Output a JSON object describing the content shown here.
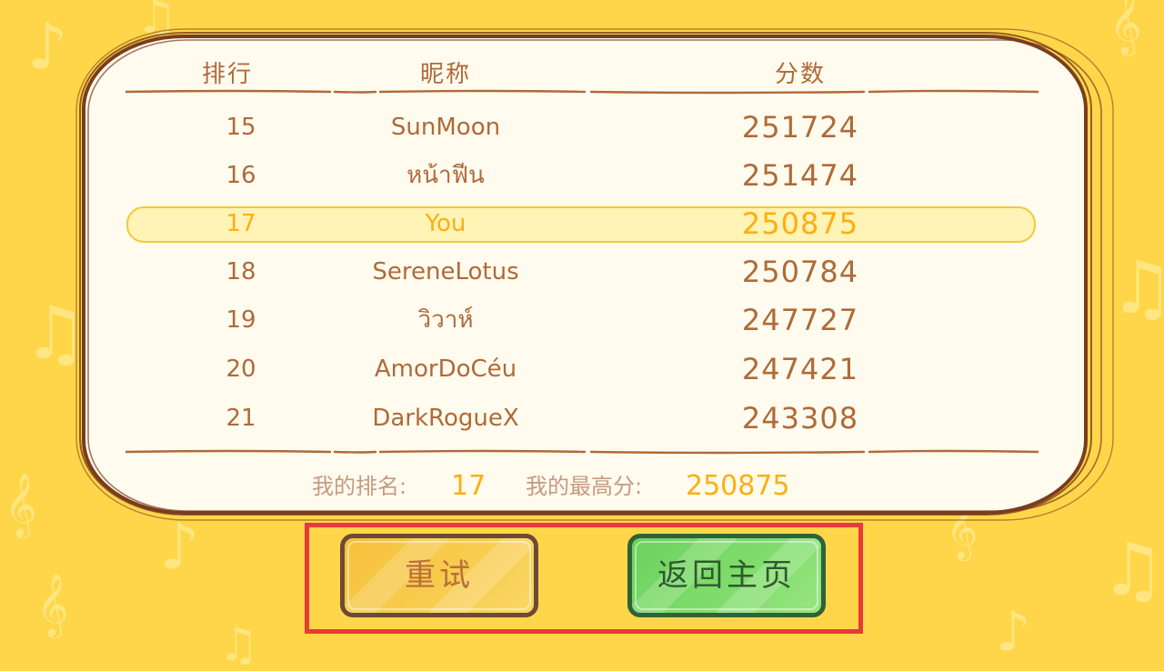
{
  "leaderboard": {
    "headers": {
      "rank": "排行",
      "name": "昵称",
      "score": "分数"
    },
    "rows": [
      {
        "rank": "15",
        "name": "SunMoon",
        "score": "251724"
      },
      {
        "rank": "16",
        "name": "หน้าฟีน",
        "score": "251474"
      },
      {
        "rank": "17",
        "name": "You",
        "score": "250875",
        "highlighted": true
      },
      {
        "rank": "18",
        "name": "SereneLotus",
        "score": "250784"
      },
      {
        "rank": "19",
        "name": "วิวาห์",
        "score": "247727"
      },
      {
        "rank": "20",
        "name": "AmorDoCéu",
        "score": "247421"
      },
      {
        "rank": "21",
        "name": "DarkRogueX",
        "score": "243308"
      }
    ]
  },
  "summary": {
    "my_rank_label": "我的排名:",
    "my_rank_value": "17",
    "my_best_label": "我的最高分:",
    "my_best_value": "250875"
  },
  "buttons": {
    "retry_label": "重试",
    "home_label": "返回主页"
  },
  "colors": {
    "background": "#ffd64a",
    "panel": "#fffcef",
    "text": "#b06a38",
    "highlight_text": "#ffae10",
    "retry_button": "#f6c13b",
    "home_button": "#6cd25f",
    "selection_box": "#e83a3a"
  },
  "icons": [
    "music-note-icon",
    "treble-clef-icon"
  ]
}
